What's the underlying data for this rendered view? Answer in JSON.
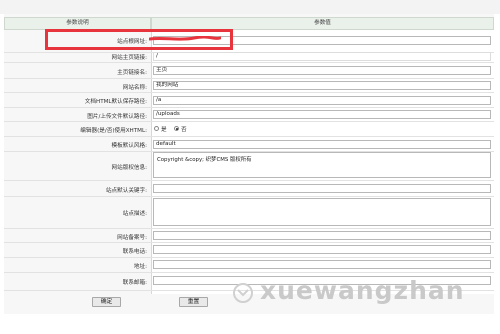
{
  "header": {
    "left": "参数说明",
    "right": "参数值"
  },
  "rows": [
    {
      "label": "站点根网址:",
      "value": ""
    },
    {
      "label": "网站主页链接:",
      "value": "/"
    },
    {
      "label": "主页链接名:",
      "value": "主页"
    },
    {
      "label": "网站名称:",
      "value": "我的网站"
    },
    {
      "label": "文档HTML默认保存路径:",
      "value": "/a"
    },
    {
      "label": "图片/上传文件默认路径:",
      "value": "/uploads"
    },
    {
      "label": "编辑器(是/否)使用XHTML:",
      "options": [
        "是",
        "否"
      ],
      "selected": "否"
    },
    {
      "label": "模板默认风格:",
      "value": "default"
    },
    {
      "label": "网站版权信息:",
      "value": "Copyright &copy; 织梦CMS 版权所有"
    },
    {
      "label": "站点默认关键字:",
      "value": ""
    },
    {
      "label": "站点描述:",
      "value": ""
    },
    {
      "label": "网站备案号:",
      "value": ""
    },
    {
      "label": "联系电话:",
      "value": ""
    },
    {
      "label": "地址:",
      "value": ""
    },
    {
      "label": "联系邮箱:",
      "value": ""
    }
  ],
  "buttons": {
    "ok": "确定",
    "reset": "重置"
  },
  "watermark": "xuewangzhan",
  "colors": {
    "highlight": "#e8343d",
    "scribble": "#e8343d"
  }
}
